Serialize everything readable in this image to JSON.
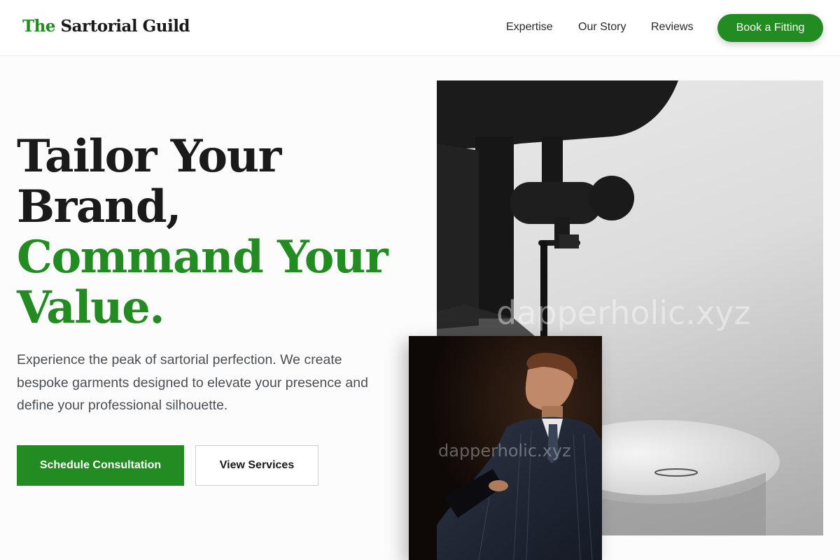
{
  "header": {
    "logo_accent": "The",
    "logo_rest": "Sartorial Guild",
    "nav": [
      "Expertise",
      "Our Story",
      "Reviews"
    ],
    "cta": "Book a Fitting"
  },
  "hero": {
    "headline_lines": [
      "Tailor Your",
      "Brand,",
      "Command Your",
      "Value."
    ],
    "description": "Experience the peak of sartorial perfection. We create bespoke garments designed to elevate your presence and define your professional silhouette.",
    "primary_button": "Schedule Consultation",
    "secondary_button": "View Services"
  },
  "images": {
    "main_alt": "Close-up of a sewing machine presser foot",
    "portrait_alt": "Man in a pinstripe suit reading",
    "watermark": "dapperholic.xyz"
  },
  "colors": {
    "accent": "#228b22",
    "text": "#1a1a1a",
    "muted": "#4a4f55"
  }
}
